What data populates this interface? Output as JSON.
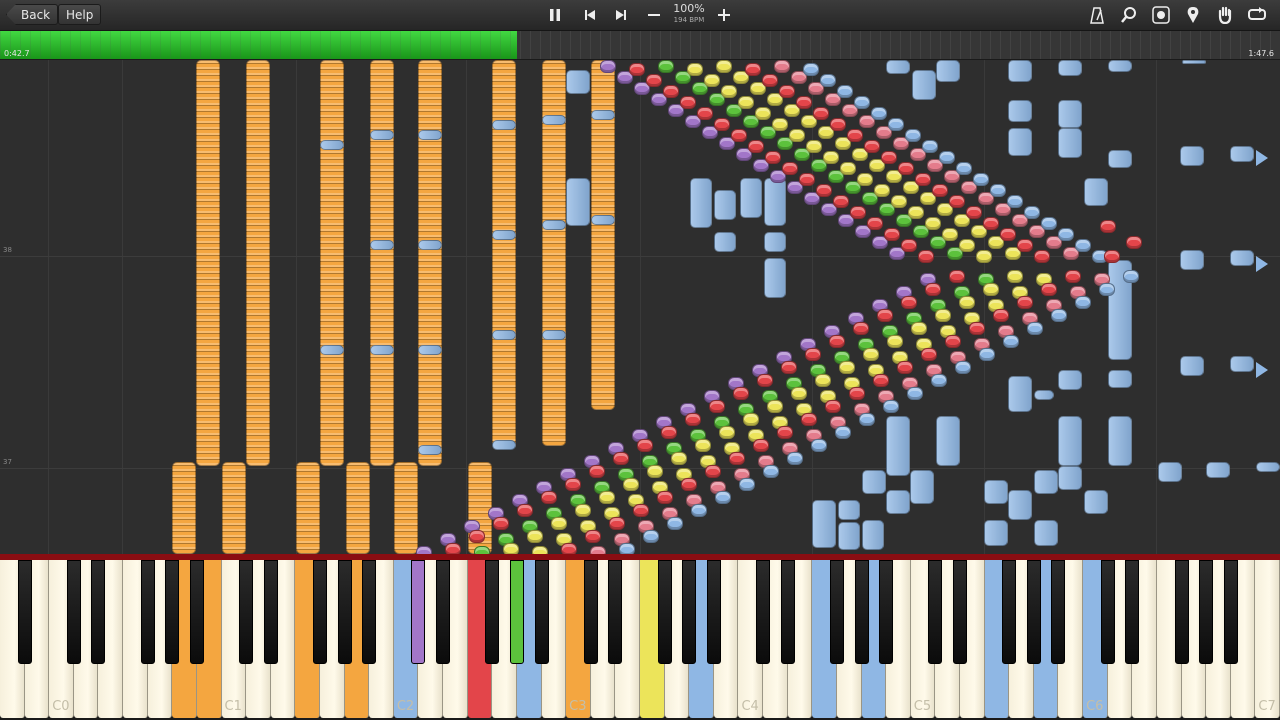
{
  "toolbar": {
    "back_label": "Back",
    "help_label": "Help",
    "tempo_percent": "100%",
    "tempo_bpm": "194 BPM"
  },
  "playback": {
    "elapsed": "0:42.7",
    "total": "1:47.6",
    "progress_fraction": 0.404
  },
  "bar_numbers": {
    "upper": "38",
    "lower": "37"
  },
  "keyboard": {
    "octave_labels": [
      "C0",
      "C1",
      "C2",
      "C3",
      "C4",
      "C5",
      "C6",
      "C7"
    ]
  },
  "colors": {
    "orange": "#f4a640",
    "blue": "#8fb7e4",
    "red": "#e3454a",
    "green": "#5cc23c",
    "yellow": "#ece45a",
    "purple": "#a276c8",
    "pink": "#e47c8c",
    "progress_green": "#2cc52c",
    "keyboard_frame": "#8a0d12"
  }
}
